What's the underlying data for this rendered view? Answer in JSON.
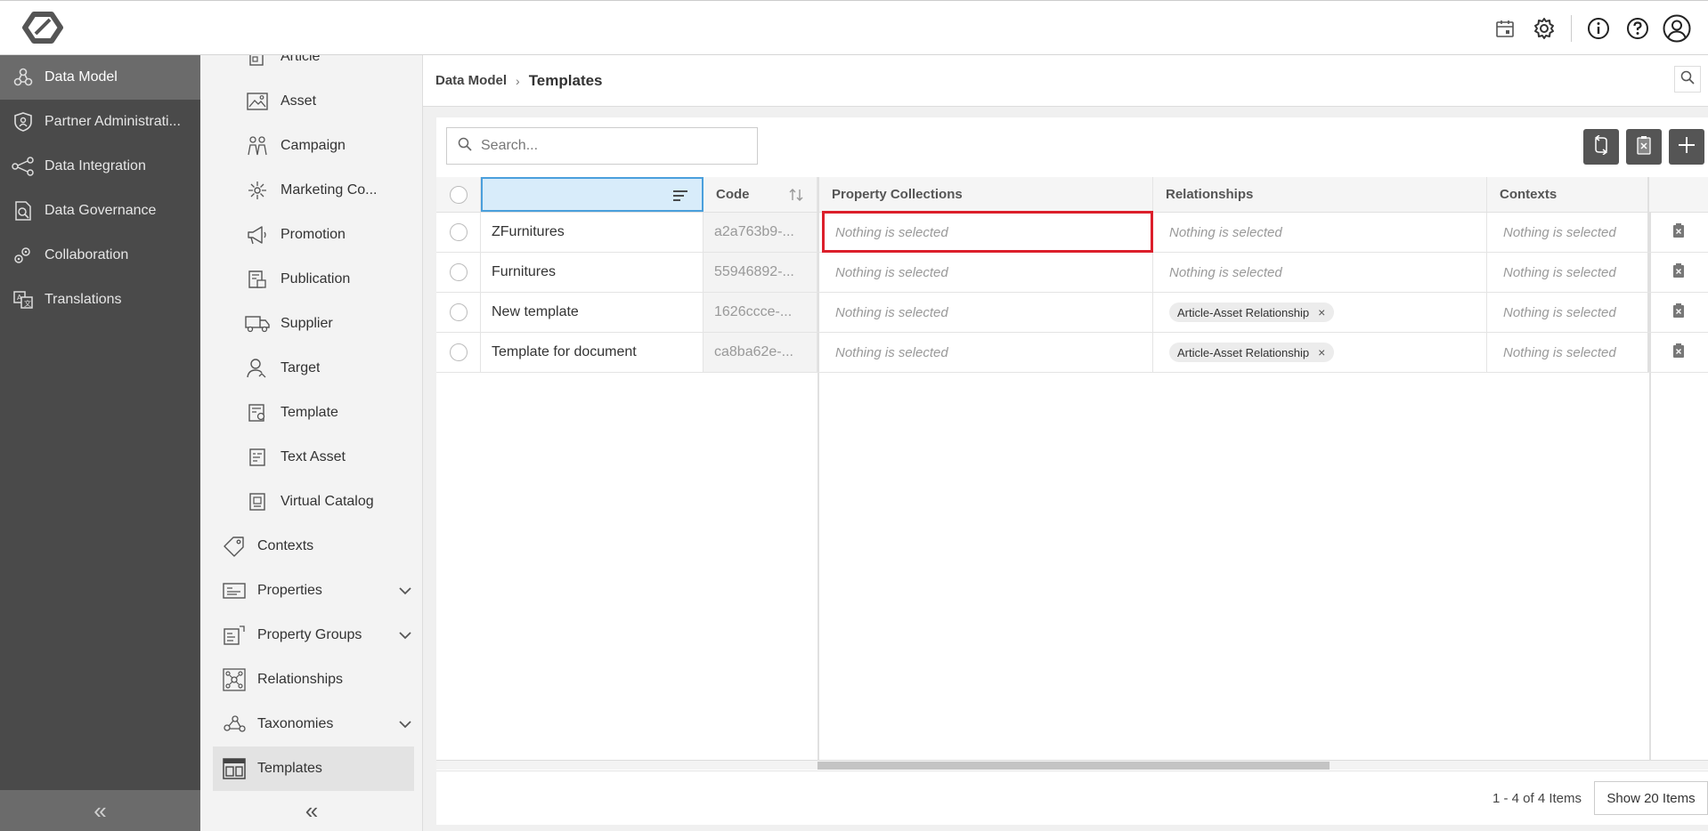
{
  "header": {
    "logo_icon": "brand-logo-icon",
    "icons": [
      "calendar-icon",
      "gear-icon",
      "info-icon",
      "help-icon",
      "user-avatar-icon"
    ]
  },
  "leftnav": {
    "items": [
      {
        "label": "Data Model",
        "icon": "data-model-icon",
        "active": true
      },
      {
        "label": "Partner Administrati...",
        "icon": "shield-icon"
      },
      {
        "label": "Data Integration",
        "icon": "integration-icon"
      },
      {
        "label": "Data Governance",
        "icon": "governance-icon"
      },
      {
        "label": "Collaboration",
        "icon": "collaboration-icon"
      },
      {
        "label": "Translations",
        "icon": "translation-icon"
      }
    ],
    "collapse_label": "«"
  },
  "subnav": {
    "items": [
      {
        "label": "Article",
        "icon": "article-icon",
        "level": "child"
      },
      {
        "label": "Asset",
        "icon": "asset-icon",
        "level": "child"
      },
      {
        "label": "Campaign",
        "icon": "campaign-icon",
        "level": "child"
      },
      {
        "label": "Marketing Co...",
        "icon": "marketing-icon",
        "level": "child"
      },
      {
        "label": "Promotion",
        "icon": "megaphone-icon",
        "level": "child"
      },
      {
        "label": "Publication",
        "icon": "publication-icon",
        "level": "child"
      },
      {
        "label": "Supplier",
        "icon": "truck-icon",
        "level": "child"
      },
      {
        "label": "Target",
        "icon": "target-user-icon",
        "level": "child"
      },
      {
        "label": "Template",
        "icon": "template-icon",
        "level": "child"
      },
      {
        "label": "Text Asset",
        "icon": "text-asset-icon",
        "level": "child"
      },
      {
        "label": "Virtual Catalog",
        "icon": "catalog-icon",
        "level": "child"
      },
      {
        "label": "Contexts",
        "icon": "tag-icon",
        "level": "parent"
      },
      {
        "label": "Properties",
        "icon": "properties-icon",
        "level": "parent",
        "expandable": true
      },
      {
        "label": "Property Groups",
        "icon": "property-groups-icon",
        "level": "parent",
        "expandable": true
      },
      {
        "label": "Relationships",
        "icon": "relationships-icon",
        "level": "parent"
      },
      {
        "label": "Taxonomies",
        "icon": "taxonomy-icon",
        "level": "parent",
        "expandable": true
      },
      {
        "label": "Templates",
        "icon": "templates-icon",
        "level": "parent",
        "active": true
      }
    ],
    "collapse_label": "«"
  },
  "breadcrumb": {
    "root": "Data Model",
    "separator": "›",
    "current": "Templates"
  },
  "toolbar": {
    "search_placeholder": "Search...",
    "buttons": [
      "refresh-icon",
      "delete-icon",
      "add-icon"
    ]
  },
  "grid": {
    "columns": {
      "name": "",
      "code": "Code",
      "property_collections": "Property Collections",
      "relationships": "Relationships",
      "contexts": "Contexts"
    },
    "rows": [
      {
        "name": "ZFurnitures",
        "code": "a2a763b9-...",
        "property_collections": "Nothing is selected",
        "relationships": "Nothing is selected",
        "relationship_chip": null,
        "contexts": "Nothing is selected"
      },
      {
        "name": "Furnitures",
        "code": "55946892-...",
        "property_collections": "Nothing is selected",
        "relationships": "Nothing is selected",
        "relationship_chip": null,
        "contexts": "Nothing is selected"
      },
      {
        "name": "New template",
        "code": "1626ccce-...",
        "property_collections": "Nothing is selected",
        "relationships": null,
        "relationship_chip": "Article-Asset Relationship",
        "contexts": "Nothing is selected"
      },
      {
        "name": "Template for document",
        "code": "ca8ba62e-...",
        "property_collections": "Nothing is selected",
        "relationships": null,
        "relationship_chip": "Article-Asset Relationship",
        "contexts": "Nothing is selected"
      }
    ],
    "chip_remove": "×"
  },
  "footer": {
    "pager_info": "1 - 4 of 4 Items",
    "page_size_button": "Show 20 Items"
  },
  "colors": {
    "leftnav_bg": "#4a4a4a",
    "leftnav_active": "#6b6b6b",
    "highlight": "#dc1f2b",
    "selected_header": "#d8ecfa"
  }
}
